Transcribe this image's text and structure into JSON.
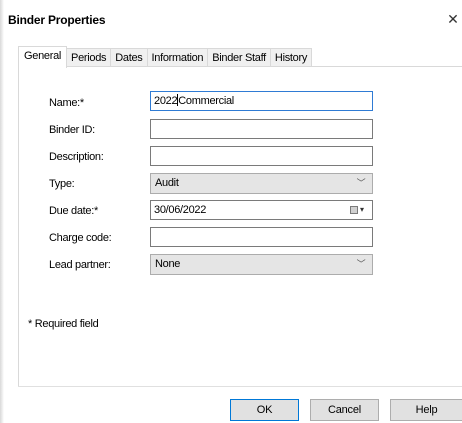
{
  "window": {
    "title": "Binder Properties",
    "close_glyph": "✕"
  },
  "tabs": [
    {
      "label": "General",
      "active": true
    },
    {
      "label": "Periods",
      "active": false
    },
    {
      "label": "Dates",
      "active": false
    },
    {
      "label": "Information",
      "active": false
    },
    {
      "label": "Binder Staff",
      "active": false
    },
    {
      "label": "History",
      "active": false
    }
  ],
  "form": {
    "name": {
      "label": "Name:*",
      "value_before_caret": "2022",
      "value_after_caret": "Commercial"
    },
    "binder_id": {
      "label": "Binder ID:",
      "value": ""
    },
    "description": {
      "label": "Description:",
      "value": ""
    },
    "type": {
      "label": "Type:",
      "value": "Audit"
    },
    "due_date": {
      "label": "Due date:*",
      "value": "30/06/2022"
    },
    "charge_code": {
      "label": "Charge code:",
      "value": ""
    },
    "lead_partner": {
      "label": "Lead partner:",
      "value": "None"
    },
    "required_note": "* Required field"
  },
  "buttons": {
    "ok": "OK",
    "cancel": "Cancel",
    "help": "Help"
  },
  "icons": {
    "chevron": "﹀",
    "dropdown_arrow": "▾"
  },
  "colors": {
    "focus_border": "#2f7bd4",
    "default_button_border": "#0078d7"
  }
}
